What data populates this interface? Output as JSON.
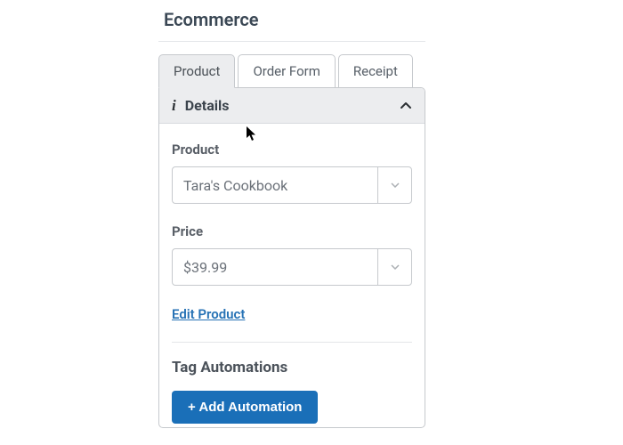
{
  "page": {
    "title": "Ecommerce"
  },
  "tabs": {
    "product": "Product",
    "orderForm": "Order Form",
    "receipt": "Receipt"
  },
  "details": {
    "sectionTitle": "Details",
    "productLabel": "Product",
    "productValue": "Tara's Cookbook",
    "priceLabel": "Price",
    "priceValue": "$39.99",
    "editLink": "Edit Product"
  },
  "tagAutomations": {
    "title": "Tag Automations",
    "addButton": "+ Add Automation"
  }
}
